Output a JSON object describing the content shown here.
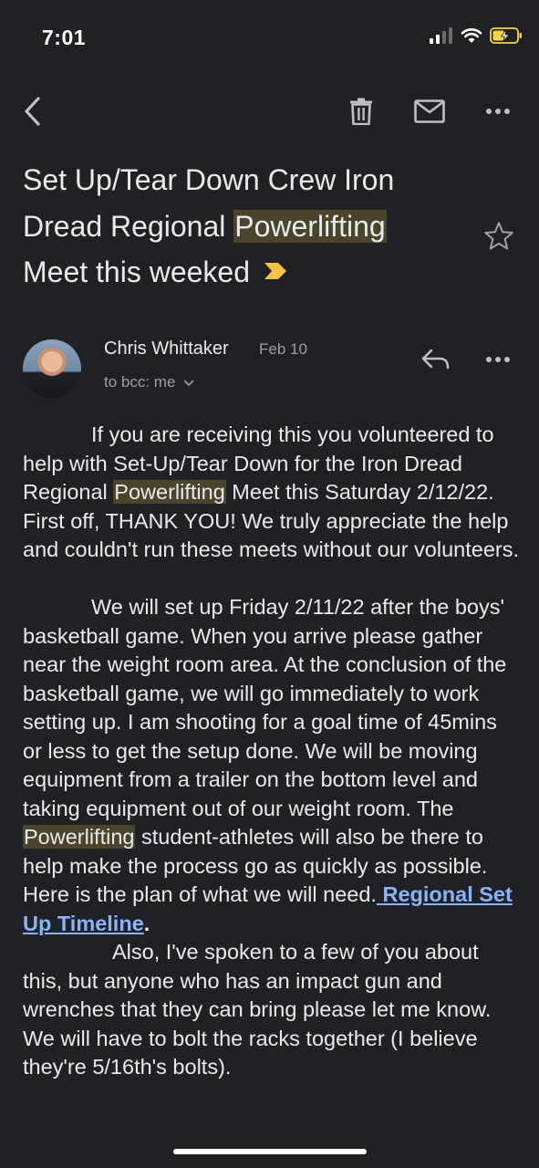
{
  "status_bar": {
    "time": "7:01",
    "icons": [
      "cellular-signal-icon",
      "wifi-icon",
      "battery-charging-icon"
    ],
    "battery_color": "#f5d442"
  },
  "toolbar": {
    "back_icon": "chevron-left-icon",
    "delete_icon": "trash-icon",
    "mark_unread_icon": "mail-icon",
    "more_icon": "more-horizontal-icon"
  },
  "email": {
    "subject_part1": "Set Up/Tear Down Crew Iron Dread Regional ",
    "subject_highlight": "Powerlifting",
    "subject_part2": " Meet this weeked",
    "importance_marker_color": "#f6c344",
    "star_icon": "star-outline-icon",
    "sender": {
      "name": "Chris Whittaker",
      "date": "Feb 10",
      "recipients": "to bcc: me"
    },
    "body": {
      "p1_a": "If you are receiving this you volunteered to help with Set-Up/Tear Down for the Iron Dread Regional ",
      "p1_hl": "Powerlifting",
      "p1_b": " Meet this Saturday 2/12/22. First off, THANK YOU! We truly appreciate the help and couldn't run these meets without our volunteers.",
      "p2_a": "We will set up Friday 2/11/22 after the boys' basketball game. When you arrive please gather near the weight room area. At the conclusion of the basketball game, we will go immediately to work setting up. I am shooting for a goal time of 45mins or less to get the setup done. We will be moving equipment from a trailer on the bottom level and taking equipment out of our weight room. The ",
      "p2_hl": "Powerlifting",
      "p2_b": " student-athletes will also be there to help make the process go as quickly as possible. Here is the plan of what we will need.",
      "p2_link": " Regional Set Up Timeline",
      "p2_end": ".",
      "p3": "Also, I've spoken to a few of you about this, but anyone who has an impact gun and wrenches that they can bring please let me know. We will have to bolt the racks together (I believe they're 5/16th's bolts)."
    }
  },
  "colors": {
    "background": "#202124",
    "highlight": "#4a442a",
    "link": "#8ab4f8"
  }
}
